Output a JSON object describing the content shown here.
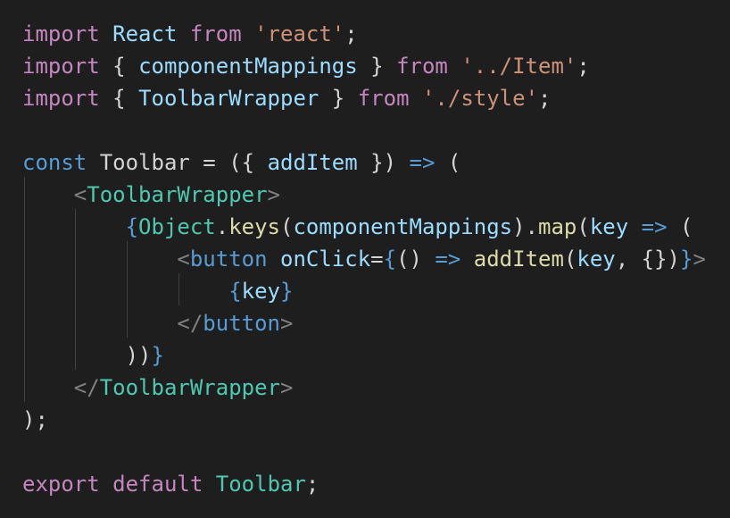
{
  "editor": {
    "background": "#1e1e1e",
    "lines": [
      [
        [
          "import",
          "kw"
        ],
        [
          " ",
          "pun"
        ],
        [
          "React",
          "var"
        ],
        [
          " ",
          "pun"
        ],
        [
          "from",
          "kw"
        ],
        [
          " ",
          "pun"
        ],
        [
          "'react'",
          "str"
        ],
        [
          ";",
          "pun"
        ]
      ],
      [
        [
          "import",
          "kw"
        ],
        [
          " { ",
          "pun"
        ],
        [
          "componentMappings",
          "var"
        ],
        [
          " } ",
          "pun"
        ],
        [
          "from",
          "kw"
        ],
        [
          " ",
          "pun"
        ],
        [
          "'../Item'",
          "str"
        ],
        [
          ";",
          "pun"
        ]
      ],
      [
        [
          "import",
          "kw"
        ],
        [
          " { ",
          "pun"
        ],
        [
          "ToolbarWrapper",
          "var"
        ],
        [
          " } ",
          "pun"
        ],
        [
          "from",
          "kw"
        ],
        [
          " ",
          "pun"
        ],
        [
          "'./style'",
          "str"
        ],
        [
          ";",
          "pun"
        ]
      ],
      [],
      [
        [
          "const",
          "decl"
        ],
        [
          " ",
          "pun"
        ],
        [
          "Toolbar",
          "plain"
        ],
        [
          " = ({ ",
          "pun"
        ],
        [
          "addItem",
          "var"
        ],
        [
          " }) ",
          "pun"
        ],
        [
          "=>",
          "decl"
        ],
        [
          " (",
          "pun"
        ]
      ],
      [
        [
          "    ",
          "pun"
        ],
        [
          "<",
          "tag-b"
        ],
        [
          "ToolbarWrapper",
          "tag"
        ],
        [
          ">",
          "tag-b"
        ]
      ],
      [
        [
          "        ",
          "pun"
        ],
        [
          "{",
          "brace"
        ],
        [
          "Object",
          "type"
        ],
        [
          ".",
          "pun"
        ],
        [
          "keys",
          "fn"
        ],
        [
          "(",
          "pun"
        ],
        [
          "componentMappings",
          "var"
        ],
        [
          ").",
          "pun"
        ],
        [
          "map",
          "fn"
        ],
        [
          "(",
          "pun"
        ],
        [
          "key",
          "var"
        ],
        [
          " ",
          "pun"
        ],
        [
          "=>",
          "decl"
        ],
        [
          " (",
          "pun"
        ]
      ],
      [
        [
          "            ",
          "pun"
        ],
        [
          "<",
          "tag-b"
        ],
        [
          "button",
          "html"
        ],
        [
          " ",
          "pun"
        ],
        [
          "onClick",
          "var"
        ],
        [
          "=",
          "pun"
        ],
        [
          "{",
          "brace"
        ],
        [
          "() ",
          "pun"
        ],
        [
          "=>",
          "decl"
        ],
        [
          " ",
          "pun"
        ],
        [
          "addItem",
          "fn"
        ],
        [
          "(",
          "pun"
        ],
        [
          "key",
          "var"
        ],
        [
          ", {})",
          "pun"
        ],
        [
          "}",
          "brace"
        ],
        [
          ">",
          "tag-b"
        ]
      ],
      [
        [
          "                ",
          "pun"
        ],
        [
          "{",
          "brace"
        ],
        [
          "key",
          "var"
        ],
        [
          "}",
          "brace"
        ]
      ],
      [
        [
          "            ",
          "pun"
        ],
        [
          "</",
          "tag-b"
        ],
        [
          "button",
          "html"
        ],
        [
          ">",
          "tag-b"
        ]
      ],
      [
        [
          "        ",
          "pun"
        ],
        [
          "))",
          "pun"
        ],
        [
          "}",
          "brace"
        ]
      ],
      [
        [
          "    ",
          "pun"
        ],
        [
          "</",
          "tag-b"
        ],
        [
          "ToolbarWrapper",
          "tag"
        ],
        [
          ">",
          "tag-b"
        ]
      ],
      [
        [
          ");",
          "pun"
        ]
      ],
      [],
      [
        [
          "export",
          "kw"
        ],
        [
          " ",
          "pun"
        ],
        [
          "default",
          "kw"
        ],
        [
          " ",
          "pun"
        ],
        [
          "Toolbar",
          "type"
        ],
        [
          ";",
          "pun"
        ]
      ]
    ]
  }
}
